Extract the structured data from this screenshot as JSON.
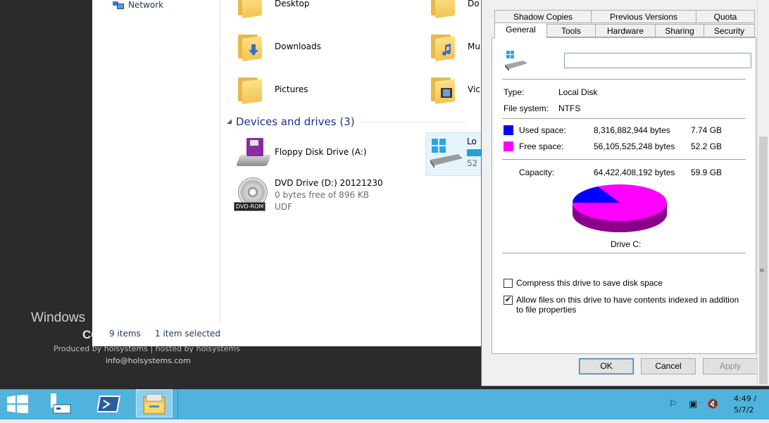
{
  "desktop": {
    "brand_line1": "Windows",
    "brand_line2": "CO",
    "produced_by": "Produced by holsystems | hosted by holsystems",
    "email": "info@holsystems.com"
  },
  "explorer": {
    "nav": {
      "network_label": "Network"
    },
    "folders": [
      {
        "label": "Desktop"
      },
      {
        "label": "Downloads"
      },
      {
        "label": "Pictures"
      },
      {
        "label": "Do"
      },
      {
        "label": "Mu"
      },
      {
        "label": "Vic"
      }
    ],
    "group": {
      "title": "Devices and drives (3)"
    },
    "drives": {
      "floppy": {
        "label": "Floppy Disk Drive (A:)"
      },
      "dvd": {
        "label": "DVD Drive (D:) 20121230",
        "free": "0 bytes free of 896 KB",
        "fs": "UDF",
        "badge": "DVD-ROM"
      },
      "local": {
        "label": "Lo",
        "sub": "52"
      }
    },
    "status": {
      "items": "9 items",
      "selected": "1 item selected"
    }
  },
  "dialog": {
    "tabs_row1": [
      "Shadow Copies",
      "Previous Versions",
      "Quota"
    ],
    "tabs_row2": [
      "General",
      "Tools",
      "Hardware",
      "Sharing",
      "Security"
    ],
    "active_tab": "General",
    "name_value": "",
    "type_label": "Type:",
    "type_value": "Local Disk",
    "fs_label": "File system:",
    "fs_value": "NTFS",
    "used": {
      "label": "Used space:",
      "bytes": "8,316,882,944 bytes",
      "size": "7.74 GB",
      "color": "#0000ff"
    },
    "free": {
      "label": "Free space:",
      "bytes": "56,105,525,248 bytes",
      "size": "52.2 GB",
      "color": "#ff00ff"
    },
    "capacity": {
      "label": "Capacity:",
      "bytes": "64,422,408,192 bytes",
      "size": "59.9 GB"
    },
    "drive_caption": "Drive C:",
    "compress": {
      "label": "Compress this drive to save disk space",
      "checked": false
    },
    "index": {
      "label": "Allow files on this drive to have contents indexed in addition to file properties",
      "checked": true
    },
    "buttons": {
      "ok": "OK",
      "cancel": "Cancel",
      "apply": "Apply"
    }
  },
  "taskbar": {
    "clock_time": "4:49 /",
    "clock_date": "5/7/2"
  },
  "colors": {
    "taskbar": "#4fb3de",
    "link": "#1e3287"
  }
}
